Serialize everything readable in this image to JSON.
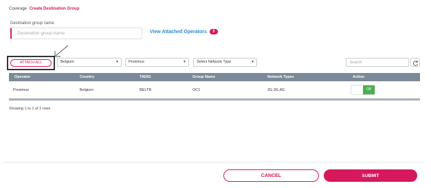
{
  "breadcrumb": {
    "parent": "Coverage",
    "current": "Create Destination Group"
  },
  "form": {
    "name_label": "Destination group name",
    "name_placeholder": "Destination group name",
    "name_value": "",
    "view_attached_label": "View Attached Operators",
    "attached_count": "0"
  },
  "toolbar": {
    "attach_all_label": "ATTACH ALL",
    "country_value": "Belgium",
    "operator_value": "Proximus",
    "network_type_value": "Select Network Type",
    "search_placeholder": "Search"
  },
  "table": {
    "columns": [
      "Operator",
      "Country",
      "TADIG",
      "Group Name",
      "Network Types",
      "Action"
    ],
    "rows": [
      {
        "operator": "Proximus",
        "country": "Belgium",
        "tadig": "BELTB",
        "group_name": "OC1",
        "network_types": "2G,3G,4G",
        "action": "Off"
      }
    ]
  },
  "pagination_text": "Showing 1 to 1 of 1 rows",
  "footer": {
    "cancel_label": "CANCEL",
    "submit_label": "SUBMIT"
  },
  "colors": {
    "accent": "#d5195c",
    "link": "#2a8ad4",
    "table_header": "#7a8a98",
    "toggle_green": "#4caf50"
  }
}
